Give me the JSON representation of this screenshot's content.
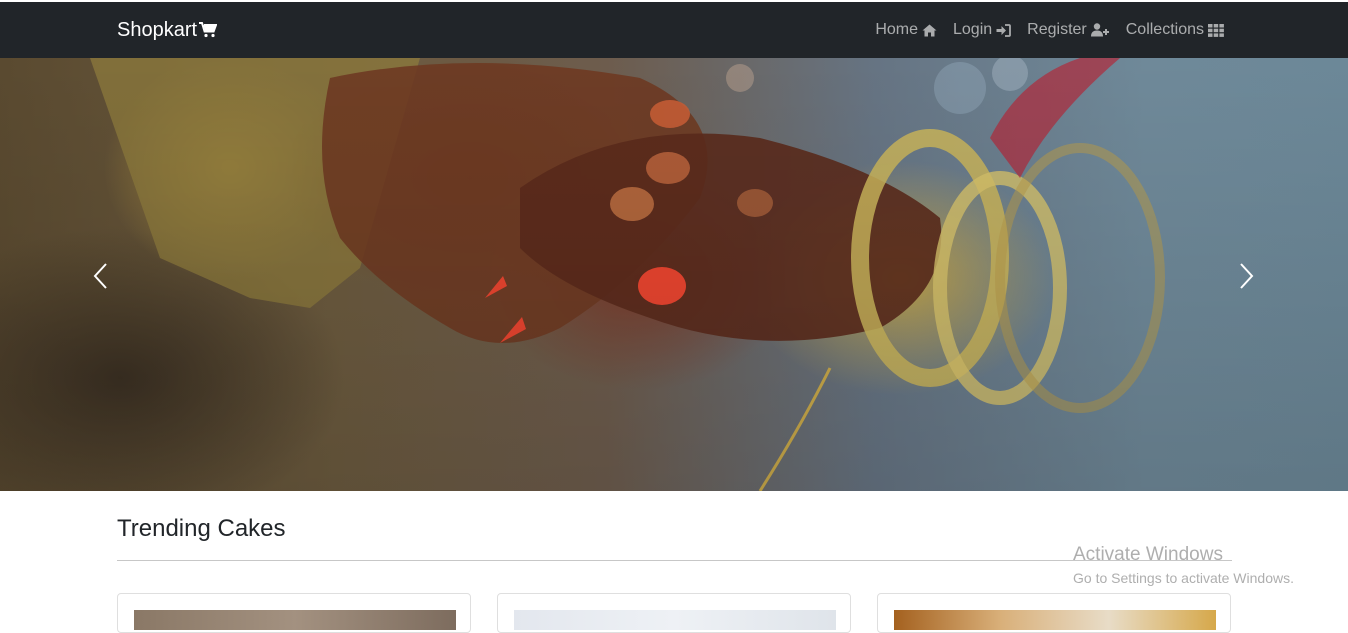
{
  "navbar": {
    "brand": "Shopkart",
    "brand_icon": "shopping-cart-icon",
    "links": [
      {
        "label": "Home",
        "icon": "home-icon"
      },
      {
        "label": "Login",
        "icon": "sign-in-icon"
      },
      {
        "label": "Register",
        "icon": "user-plus-icon"
      },
      {
        "label": "Collections",
        "icon": "grid-icon"
      }
    ]
  },
  "carousel": {
    "prev_icon": "chevron-left-icon",
    "next_icon": "chevron-right-icon"
  },
  "section": {
    "title": "Trending Cakes"
  },
  "watermark": {
    "title": "Activate Windows",
    "subtitle": "Go to Settings to activate Windows."
  },
  "colors": {
    "navbar_bg": "#212529",
    "nav_link": "rgba(255,255,255,0.62)",
    "brand": "#ffffff"
  }
}
